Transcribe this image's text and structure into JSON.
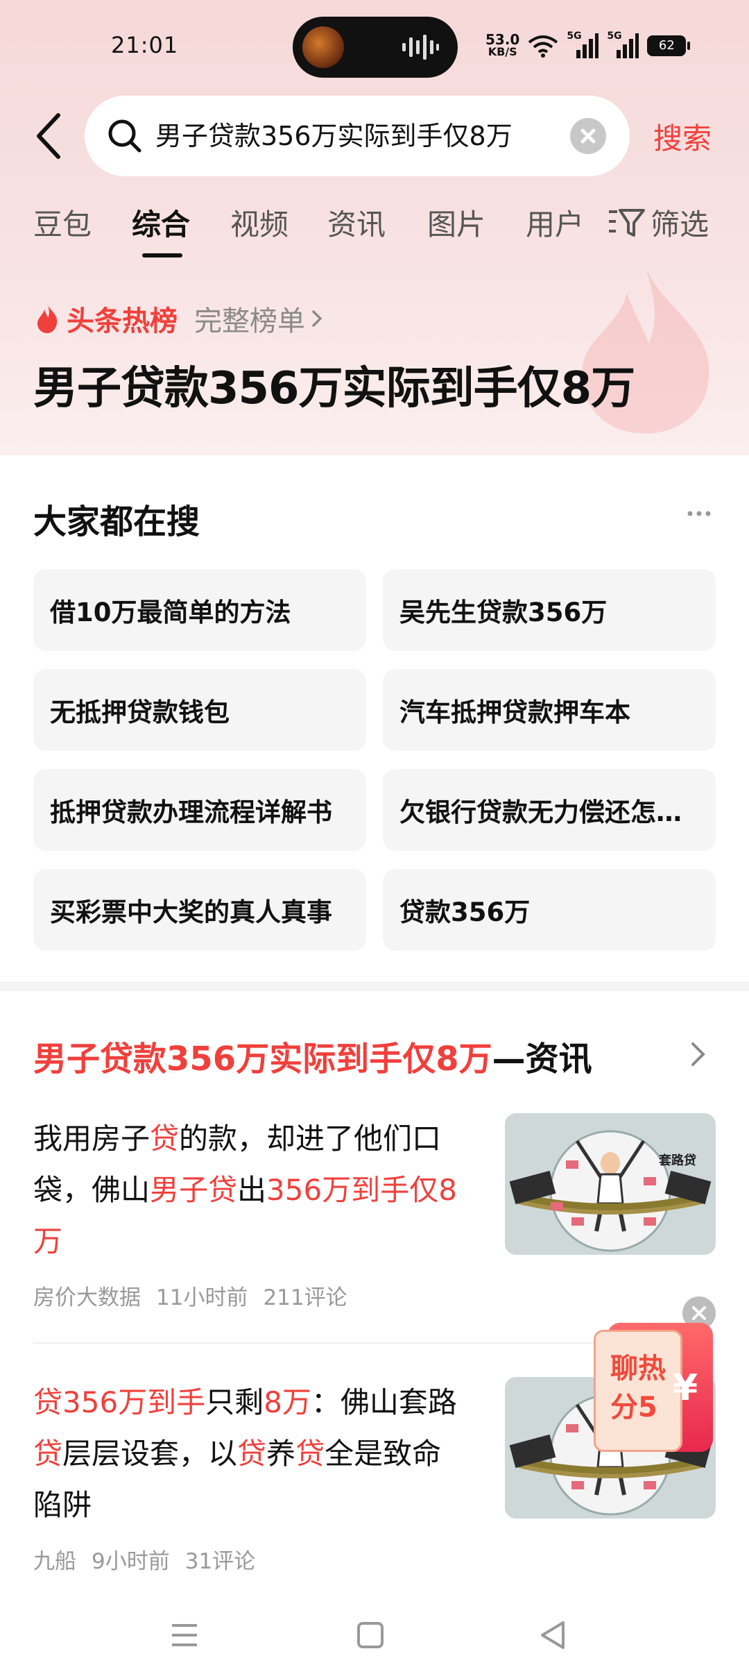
{
  "status_bar": {
    "time": "21:01",
    "net_speed_value": "53.0",
    "net_speed_unit": "KB/S",
    "signal1_label": "5G",
    "signal2_label": "5G",
    "battery": "62"
  },
  "search": {
    "query": "男子贷款356万实际到手仅8万",
    "submit_label": "搜索"
  },
  "tabs": [
    {
      "label": "豆包"
    },
    {
      "label": "综合"
    },
    {
      "label": "视频"
    },
    {
      "label": "资讯"
    },
    {
      "label": "图片"
    },
    {
      "label": "用户"
    }
  ],
  "active_tab": "综合",
  "filter_label": "筛选",
  "hot": {
    "label": "头条热榜",
    "full_list": "完整榜单",
    "title": "男子贷款356万实际到手仅8万"
  },
  "everyone_searches": {
    "title": "大家都在搜",
    "items": [
      "借10万最简单的方法",
      "吴先生贷款356万",
      "无抵押贷款钱包",
      "汽车抵押贷款押车本",
      "抵押贷款办理流程详解书",
      "欠银行贷款无力偿还怎…",
      "买彩票中大奖的真人真事",
      "贷款356万"
    ]
  },
  "news": {
    "header_highlight": "男子贷款356万实际到手仅8万",
    "header_suffix": "—资讯",
    "articles": [
      {
        "title_parts": [
          {
            "text": "我用房子",
            "hl": false
          },
          {
            "text": "贷",
            "hl": true
          },
          {
            "text": "的款，却进了他们口袋，佛山",
            "hl": false
          },
          {
            "text": "男子贷",
            "hl": true
          },
          {
            "text": "出",
            "hl": false
          },
          {
            "text": "356万到手仅8万",
            "hl": true
          }
        ],
        "thumb_caption": "套路贷",
        "source": "房价大数据",
        "time": "11小时前",
        "comments": "211评论"
      },
      {
        "title_parts": [
          {
            "text": "贷356万到手",
            "hl": true
          },
          {
            "text": "只剩",
            "hl": false
          },
          {
            "text": "8万",
            "hl": true
          },
          {
            "text": "：佛山套路",
            "hl": false
          },
          {
            "text": "贷",
            "hl": true
          },
          {
            "text": "层层设套，以",
            "hl": false
          },
          {
            "text": "贷",
            "hl": true
          },
          {
            "text": "养",
            "hl": false
          },
          {
            "text": "贷",
            "hl": true
          },
          {
            "text": "全是致命陷阱",
            "hl": false
          }
        ],
        "thumb_caption": "",
        "source": "九船",
        "time": "9小时前",
        "comments": "31评论"
      }
    ]
  },
  "promo": {
    "text_line1": "聊热",
    "text_line2": "分5",
    "symbol": "¥"
  },
  "colors": {
    "accent": "#f0403c",
    "header_bg": "#f7dede",
    "pill_bg": "#f5f5f5"
  }
}
